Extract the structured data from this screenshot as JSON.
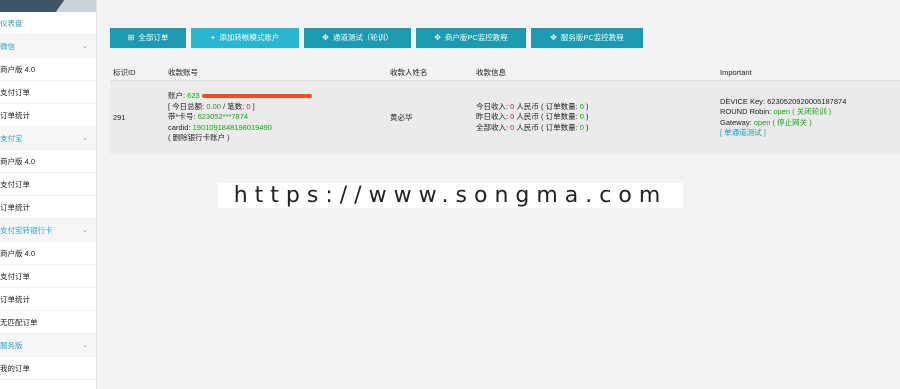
{
  "sidebar": {
    "items": [
      {
        "label": "仪表盘",
        "kind": "top"
      },
      {
        "label": "微信",
        "kind": "group"
      },
      {
        "label": "商户版 4.0",
        "kind": "item"
      },
      {
        "label": "支付订单",
        "kind": "item"
      },
      {
        "label": "订单统计",
        "kind": "item"
      },
      {
        "label": "支付宝",
        "kind": "group"
      },
      {
        "label": "商户版 4.0",
        "kind": "item"
      },
      {
        "label": "支付订单",
        "kind": "item"
      },
      {
        "label": "订单统计",
        "kind": "item"
      },
      {
        "label": "支付宝转银行卡",
        "kind": "group"
      },
      {
        "label": "商户版 4.0",
        "kind": "item"
      },
      {
        "label": "支付订单",
        "kind": "item"
      },
      {
        "label": "订单统计",
        "kind": "item"
      },
      {
        "label": "无匹配订单",
        "kind": "item"
      },
      {
        "label": "服务版",
        "kind": "group"
      },
      {
        "label": "我的订单",
        "kind": "item"
      }
    ]
  },
  "toolbar": {
    "buttons": [
      {
        "label": "全部订单",
        "icon": "grid-icon"
      },
      {
        "label": "添加转帐模式账户",
        "icon": "plus-icon"
      },
      {
        "label": "通道测试（轮训）",
        "icon": "move-icon"
      },
      {
        "label": "商户版PC监控教程",
        "icon": "move-icon"
      },
      {
        "label": "服务版PC监控教程",
        "icon": "move-icon"
      }
    ]
  },
  "table": {
    "headers": {
      "id": "标识ID",
      "account": "收款账号",
      "name": "收款人姓名",
      "info": "收款信息",
      "important": "Important"
    },
    "row": {
      "id": "291",
      "account_prefix": "账户: ",
      "account_value": "623",
      "today_label": "[ 今日总额: ",
      "today_amount": "0.00",
      "count_sep": " / 笔数: ",
      "count_value": "0",
      "count_close": " ]",
      "card_label": "带*卡号: ",
      "card_value": "623052***7874",
      "cardid_label": "cardid: ",
      "cardid_value": "1901091848198019490",
      "delete_link": "( 删除银行卡账户 )",
      "name": "黄必华",
      "today_income_label": "今日收入: ",
      "today_income": "0",
      "yesterday_income_label": "昨日收入: ",
      "yesterday_income": "0",
      "total_income_label": "全部收入: ",
      "total_income": "0",
      "currency": " 人民币 ( 订单数量: ",
      "today_orders": "0",
      "yesterday_orders": "0",
      "total_orders": "0",
      "orders_close": " )",
      "device_key_label": "DEVICE Key: ",
      "device_key": "6230520920005187874",
      "round_robin_label": "ROUND Robin: ",
      "round_robin_status": "open",
      "round_robin_action": " ( 关闭轮训 )",
      "gateway_label": "Gateway: ",
      "gateway_status": "open",
      "gateway_action": " ( 停止网关 )",
      "channel_test": "[ 单通道测试 ]"
    }
  },
  "watermark": "https://www.songma.com"
}
